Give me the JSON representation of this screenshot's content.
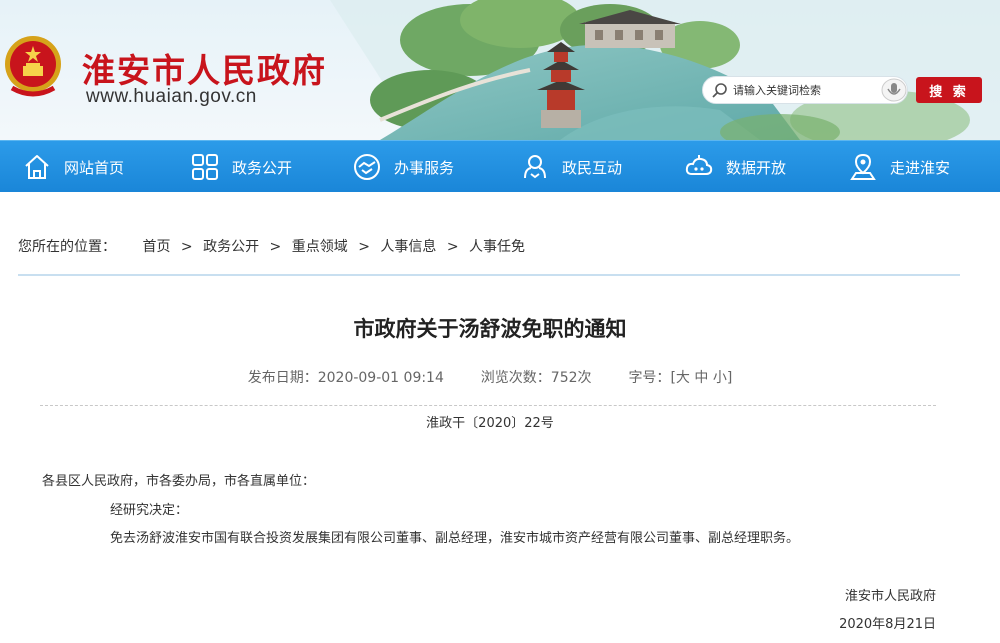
{
  "header": {
    "site_title": "淮安市人民政府",
    "site_url": "www.huaian.gov.cn",
    "search_placeholder": "请输入关键词检索",
    "search_button": "搜 索",
    "emblem_icon": "national-emblem-icon",
    "brand_red": "#c8141c"
  },
  "nav": {
    "bar_color": "#1f8fdf",
    "items": [
      {
        "label": "网站首页",
        "icon": "home-icon"
      },
      {
        "label": "政务公开",
        "icon": "grid-icon"
      },
      {
        "label": "办事服务",
        "icon": "handshake-icon"
      },
      {
        "label": "政民互动",
        "icon": "interaction-icon"
      },
      {
        "label": "数据开放",
        "icon": "cloud-data-icon"
      },
      {
        "label": "走进淮安",
        "icon": "location-pin-icon"
      }
    ]
  },
  "breadcrumb": {
    "lead": "您所在的位置：",
    "items": [
      "首页",
      "政务公开",
      "重点领域",
      "人事信息",
      "人事任免"
    ],
    "separator": ">"
  },
  "article": {
    "title": "市政府关于汤舒波免职的通知",
    "publish_label": "发布日期：",
    "publish_value": "2020-09-01 09:14",
    "views_label": "浏览次数：",
    "views_value": "752次",
    "font_label": "字号：",
    "font_open": "[",
    "font_large": "大",
    "font_medium": "中",
    "font_small": "小",
    "font_close": "]",
    "doc_number": "淮政干〔2020〕22号",
    "salutation": "各县区人民政府，市各委办局，市各直属单位：",
    "line2": "经研究决定：",
    "line3": "免去汤舒波淮安市国有联合投资发展集团有限公司董事、副总经理，淮安市城市资产经营有限公司董事、副总经理职务。",
    "signature": "淮安市人民政府",
    "date": "2020年8月21日"
  }
}
